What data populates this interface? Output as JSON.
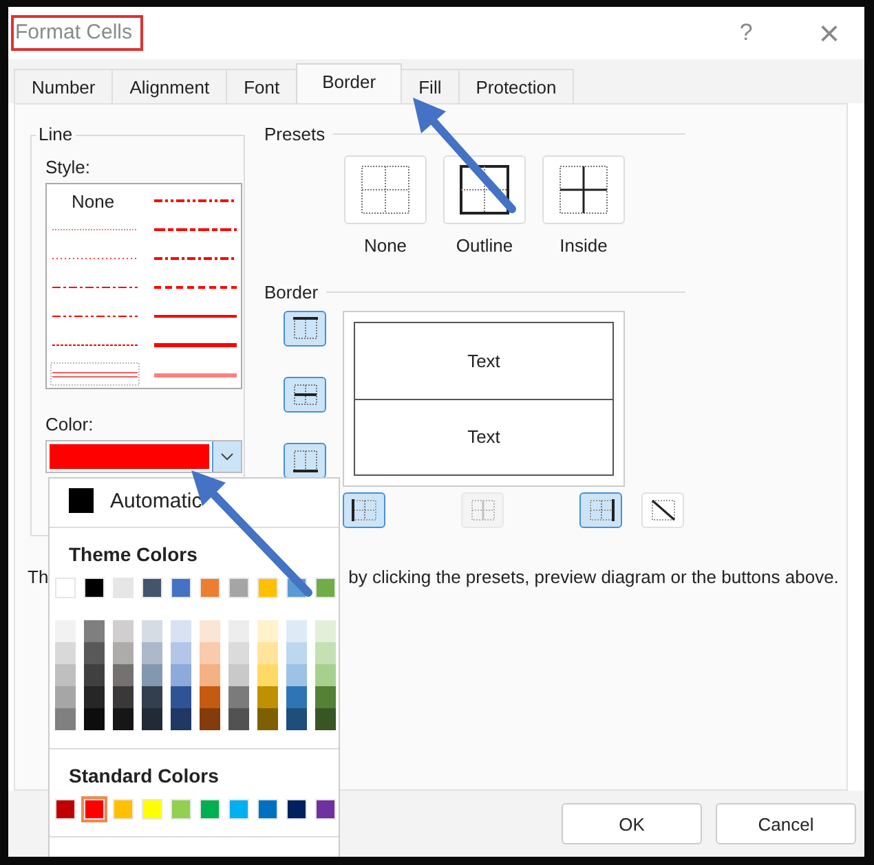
{
  "window": {
    "title": "Format Cells",
    "help": "?",
    "close": "×"
  },
  "tabs": [
    {
      "label": "Number",
      "selected": false
    },
    {
      "label": "Alignment",
      "selected": false
    },
    {
      "label": "Font",
      "selected": false
    },
    {
      "label": "Border",
      "selected": true
    },
    {
      "label": "Fill",
      "selected": false
    },
    {
      "label": "Protection",
      "selected": false
    }
  ],
  "line": {
    "heading": "Line",
    "style_label": "Style:",
    "style_none": "None",
    "color_label": "Color:",
    "color": "#ff0000"
  },
  "presets": {
    "heading": "Presets",
    "items": [
      {
        "label": "None",
        "kind": "none"
      },
      {
        "label": "Outline",
        "kind": "outline"
      },
      {
        "label": "Inside",
        "kind": "inside"
      }
    ]
  },
  "border": {
    "heading": "Border",
    "preview_texts": [
      "Text",
      "Text"
    ],
    "buttons": [
      {
        "kind": "top",
        "pressed": true,
        "disabled": false
      },
      {
        "kind": "middle-horizontal",
        "pressed": true,
        "disabled": false
      },
      {
        "kind": "bottom",
        "pressed": true,
        "disabled": false
      },
      {
        "kind": "left",
        "pressed": true,
        "disabled": false
      },
      {
        "kind": "middle-vertical",
        "pressed": false,
        "disabled": true
      },
      {
        "kind": "right",
        "pressed": true,
        "disabled": false
      },
      {
        "kind": "diagonal-down",
        "pressed": false,
        "disabled": false
      }
    ]
  },
  "hint": {
    "start": "Th",
    "end": "by clicking the presets, preview diagram or the buttons above."
  },
  "color_menu": {
    "automatic": "Automatic",
    "theme_heading": "Theme Colors",
    "theme_colors": [
      {
        "color": "#ffffff",
        "shades": [
          {
            "color": "#f2f2f2"
          },
          {
            "color": "#d9d9d9"
          },
          {
            "color": "#bfbfbf"
          },
          {
            "color": "#a6a6a6"
          },
          {
            "color": "#808080"
          }
        ]
      },
      {
        "color": "#000000",
        "shades": [
          {
            "color": "#7f7f7f"
          },
          {
            "color": "#595959"
          },
          {
            "color": "#404040"
          },
          {
            "color": "#262626"
          },
          {
            "color": "#0d0d0d"
          }
        ]
      },
      {
        "color": "#e7e6e6",
        "shades": [
          {
            "color": "#d0cece"
          },
          {
            "color": "#aeabab"
          },
          {
            "color": "#757171"
          },
          {
            "color": "#3a3838"
          },
          {
            "color": "#171616"
          }
        ]
      },
      {
        "color": "#44546a",
        "shades": [
          {
            "color": "#d6dce4"
          },
          {
            "color": "#adb9ca"
          },
          {
            "color": "#8497b0"
          },
          {
            "color": "#333f4f"
          },
          {
            "color": "#222a35"
          }
        ]
      },
      {
        "color": "#4472c4",
        "shades": [
          {
            "color": "#d9e2f3"
          },
          {
            "color": "#b4c6e7"
          },
          {
            "color": "#8eaadb"
          },
          {
            "color": "#2f5496"
          },
          {
            "color": "#1f3864"
          }
        ]
      },
      {
        "color": "#ed7d31",
        "shades": [
          {
            "color": "#fbe5d5"
          },
          {
            "color": "#f7cbac"
          },
          {
            "color": "#f4b183"
          },
          {
            "color": "#c55a11"
          },
          {
            "color": "#833c0b"
          }
        ]
      },
      {
        "color": "#a5a5a5",
        "shades": [
          {
            "color": "#ededed"
          },
          {
            "color": "#dbdbdb"
          },
          {
            "color": "#c9c9c9"
          },
          {
            "color": "#7b7b7b"
          },
          {
            "color": "#525252"
          }
        ]
      },
      {
        "color": "#ffc000",
        "shades": [
          {
            "color": "#fff2cc"
          },
          {
            "color": "#fee599"
          },
          {
            "color": "#ffd965"
          },
          {
            "color": "#bf9000"
          },
          {
            "color": "#7f6000"
          }
        ]
      },
      {
        "color": "#5b9bd5",
        "shades": [
          {
            "color": "#deebf6"
          },
          {
            "color": "#bdd7ee"
          },
          {
            "color": "#9cc3e5"
          },
          {
            "color": "#2e75b5"
          },
          {
            "color": "#1e4e79"
          }
        ]
      },
      {
        "color": "#70ad47",
        "shades": [
          {
            "color": "#e2efd9"
          },
          {
            "color": "#c5e0b3"
          },
          {
            "color": "#a8d08d"
          },
          {
            "color": "#538135"
          },
          {
            "color": "#375623"
          }
        ]
      }
    ],
    "standard_heading": "Standard Colors",
    "standard_colors": [
      {
        "color": "#c00000",
        "selected": false
      },
      {
        "color": "#ff0000",
        "selected": true
      },
      {
        "color": "#ffc000",
        "selected": false
      },
      {
        "color": "#ffff00",
        "selected": false
      },
      {
        "color": "#92d050",
        "selected": false
      },
      {
        "color": "#00b050",
        "selected": false
      },
      {
        "color": "#00b0f0",
        "selected": false
      },
      {
        "color": "#0070c0",
        "selected": false
      },
      {
        "color": "#002060",
        "selected": false
      },
      {
        "color": "#7030a0",
        "selected": false
      }
    ]
  },
  "buttons": [
    "OK",
    "Cancel"
  ]
}
